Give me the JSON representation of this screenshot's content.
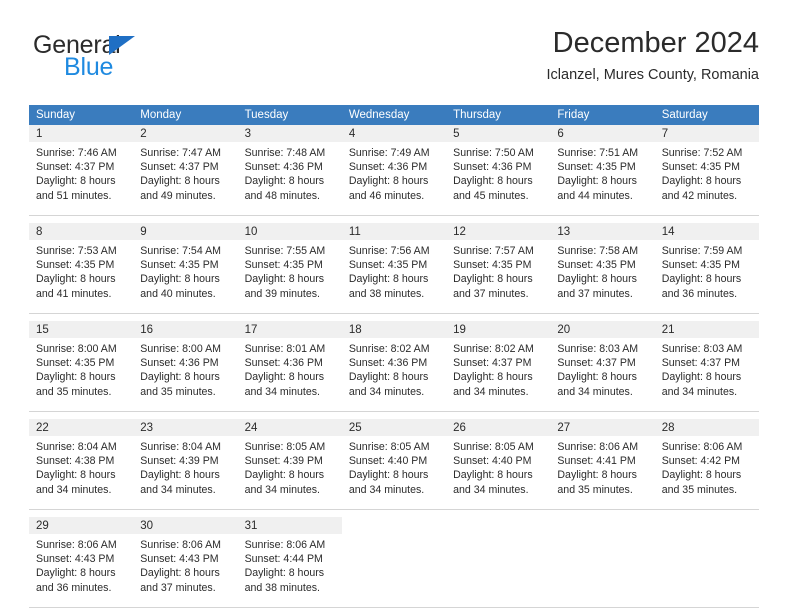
{
  "brand": {
    "name_part1": "General",
    "name_part2": "Blue",
    "triangle_color": "#1f6fc4",
    "blue_color": "#1f8ae0"
  },
  "header": {
    "month_title": "December 2024",
    "location": "Iclanzel, Mures County, Romania"
  },
  "theme": {
    "header_bg": "#3a7cbe",
    "header_text": "#ffffff",
    "daynum_band_bg": "#f0f0f0",
    "cell_bg": "#ffffff",
    "grid_line": "#d5d5d5",
    "text": "#2b2b2b"
  },
  "weekday_headers": [
    "Sunday",
    "Monday",
    "Tuesday",
    "Wednesday",
    "Thursday",
    "Friday",
    "Saturday"
  ],
  "weeks": [
    [
      {
        "day": "1",
        "sunrise": "Sunrise: 7:46 AM",
        "sunset": "Sunset: 4:37 PM",
        "daylight_line1": "Daylight: 8 hours",
        "daylight_line2": "and 51 minutes."
      },
      {
        "day": "2",
        "sunrise": "Sunrise: 7:47 AM",
        "sunset": "Sunset: 4:37 PM",
        "daylight_line1": "Daylight: 8 hours",
        "daylight_line2": "and 49 minutes."
      },
      {
        "day": "3",
        "sunrise": "Sunrise: 7:48 AM",
        "sunset": "Sunset: 4:36 PM",
        "daylight_line1": "Daylight: 8 hours",
        "daylight_line2": "and 48 minutes."
      },
      {
        "day": "4",
        "sunrise": "Sunrise: 7:49 AM",
        "sunset": "Sunset: 4:36 PM",
        "daylight_line1": "Daylight: 8 hours",
        "daylight_line2": "and 46 minutes."
      },
      {
        "day": "5",
        "sunrise": "Sunrise: 7:50 AM",
        "sunset": "Sunset: 4:36 PM",
        "daylight_line1": "Daylight: 8 hours",
        "daylight_line2": "and 45 minutes."
      },
      {
        "day": "6",
        "sunrise": "Sunrise: 7:51 AM",
        "sunset": "Sunset: 4:35 PM",
        "daylight_line1": "Daylight: 8 hours",
        "daylight_line2": "and 44 minutes."
      },
      {
        "day": "7",
        "sunrise": "Sunrise: 7:52 AM",
        "sunset": "Sunset: 4:35 PM",
        "daylight_line1": "Daylight: 8 hours",
        "daylight_line2": "and 42 minutes."
      }
    ],
    [
      {
        "day": "8",
        "sunrise": "Sunrise: 7:53 AM",
        "sunset": "Sunset: 4:35 PM",
        "daylight_line1": "Daylight: 8 hours",
        "daylight_line2": "and 41 minutes."
      },
      {
        "day": "9",
        "sunrise": "Sunrise: 7:54 AM",
        "sunset": "Sunset: 4:35 PM",
        "daylight_line1": "Daylight: 8 hours",
        "daylight_line2": "and 40 minutes."
      },
      {
        "day": "10",
        "sunrise": "Sunrise: 7:55 AM",
        "sunset": "Sunset: 4:35 PM",
        "daylight_line1": "Daylight: 8 hours",
        "daylight_line2": "and 39 minutes."
      },
      {
        "day": "11",
        "sunrise": "Sunrise: 7:56 AM",
        "sunset": "Sunset: 4:35 PM",
        "daylight_line1": "Daylight: 8 hours",
        "daylight_line2": "and 38 minutes."
      },
      {
        "day": "12",
        "sunrise": "Sunrise: 7:57 AM",
        "sunset": "Sunset: 4:35 PM",
        "daylight_line1": "Daylight: 8 hours",
        "daylight_line2": "and 37 minutes."
      },
      {
        "day": "13",
        "sunrise": "Sunrise: 7:58 AM",
        "sunset": "Sunset: 4:35 PM",
        "daylight_line1": "Daylight: 8 hours",
        "daylight_line2": "and 37 minutes."
      },
      {
        "day": "14",
        "sunrise": "Sunrise: 7:59 AM",
        "sunset": "Sunset: 4:35 PM",
        "daylight_line1": "Daylight: 8 hours",
        "daylight_line2": "and 36 minutes."
      }
    ],
    [
      {
        "day": "15",
        "sunrise": "Sunrise: 8:00 AM",
        "sunset": "Sunset: 4:35 PM",
        "daylight_line1": "Daylight: 8 hours",
        "daylight_line2": "and 35 minutes."
      },
      {
        "day": "16",
        "sunrise": "Sunrise: 8:00 AM",
        "sunset": "Sunset: 4:36 PM",
        "daylight_line1": "Daylight: 8 hours",
        "daylight_line2": "and 35 minutes."
      },
      {
        "day": "17",
        "sunrise": "Sunrise: 8:01 AM",
        "sunset": "Sunset: 4:36 PM",
        "daylight_line1": "Daylight: 8 hours",
        "daylight_line2": "and 34 minutes."
      },
      {
        "day": "18",
        "sunrise": "Sunrise: 8:02 AM",
        "sunset": "Sunset: 4:36 PM",
        "daylight_line1": "Daylight: 8 hours",
        "daylight_line2": "and 34 minutes."
      },
      {
        "day": "19",
        "sunrise": "Sunrise: 8:02 AM",
        "sunset": "Sunset: 4:37 PM",
        "daylight_line1": "Daylight: 8 hours",
        "daylight_line2": "and 34 minutes."
      },
      {
        "day": "20",
        "sunrise": "Sunrise: 8:03 AM",
        "sunset": "Sunset: 4:37 PM",
        "daylight_line1": "Daylight: 8 hours",
        "daylight_line2": "and 34 minutes."
      },
      {
        "day": "21",
        "sunrise": "Sunrise: 8:03 AM",
        "sunset": "Sunset: 4:37 PM",
        "daylight_line1": "Daylight: 8 hours",
        "daylight_line2": "and 34 minutes."
      }
    ],
    [
      {
        "day": "22",
        "sunrise": "Sunrise: 8:04 AM",
        "sunset": "Sunset: 4:38 PM",
        "daylight_line1": "Daylight: 8 hours",
        "daylight_line2": "and 34 minutes."
      },
      {
        "day": "23",
        "sunrise": "Sunrise: 8:04 AM",
        "sunset": "Sunset: 4:39 PM",
        "daylight_line1": "Daylight: 8 hours",
        "daylight_line2": "and 34 minutes."
      },
      {
        "day": "24",
        "sunrise": "Sunrise: 8:05 AM",
        "sunset": "Sunset: 4:39 PM",
        "daylight_line1": "Daylight: 8 hours",
        "daylight_line2": "and 34 minutes."
      },
      {
        "day": "25",
        "sunrise": "Sunrise: 8:05 AM",
        "sunset": "Sunset: 4:40 PM",
        "daylight_line1": "Daylight: 8 hours",
        "daylight_line2": "and 34 minutes."
      },
      {
        "day": "26",
        "sunrise": "Sunrise: 8:05 AM",
        "sunset": "Sunset: 4:40 PM",
        "daylight_line1": "Daylight: 8 hours",
        "daylight_line2": "and 34 minutes."
      },
      {
        "day": "27",
        "sunrise": "Sunrise: 8:06 AM",
        "sunset": "Sunset: 4:41 PM",
        "daylight_line1": "Daylight: 8 hours",
        "daylight_line2": "and 35 minutes."
      },
      {
        "day": "28",
        "sunrise": "Sunrise: 8:06 AM",
        "sunset": "Sunset: 4:42 PM",
        "daylight_line1": "Daylight: 8 hours",
        "daylight_line2": "and 35 minutes."
      }
    ],
    [
      {
        "day": "29",
        "sunrise": "Sunrise: 8:06 AM",
        "sunset": "Sunset: 4:43 PM",
        "daylight_line1": "Daylight: 8 hours",
        "daylight_line2": "and 36 minutes."
      },
      {
        "day": "30",
        "sunrise": "Sunrise: 8:06 AM",
        "sunset": "Sunset: 4:43 PM",
        "daylight_line1": "Daylight: 8 hours",
        "daylight_line2": "and 37 minutes."
      },
      {
        "day": "31",
        "sunrise": "Sunrise: 8:06 AM",
        "sunset": "Sunset: 4:44 PM",
        "daylight_line1": "Daylight: 8 hours",
        "daylight_line2": "and 38 minutes."
      },
      {
        "day": "",
        "sunrise": "",
        "sunset": "",
        "daylight_line1": "",
        "daylight_line2": ""
      },
      {
        "day": "",
        "sunrise": "",
        "sunset": "",
        "daylight_line1": "",
        "daylight_line2": ""
      },
      {
        "day": "",
        "sunrise": "",
        "sunset": "",
        "daylight_line1": "",
        "daylight_line2": ""
      },
      {
        "day": "",
        "sunrise": "",
        "sunset": "",
        "daylight_line1": "",
        "daylight_line2": ""
      }
    ]
  ]
}
